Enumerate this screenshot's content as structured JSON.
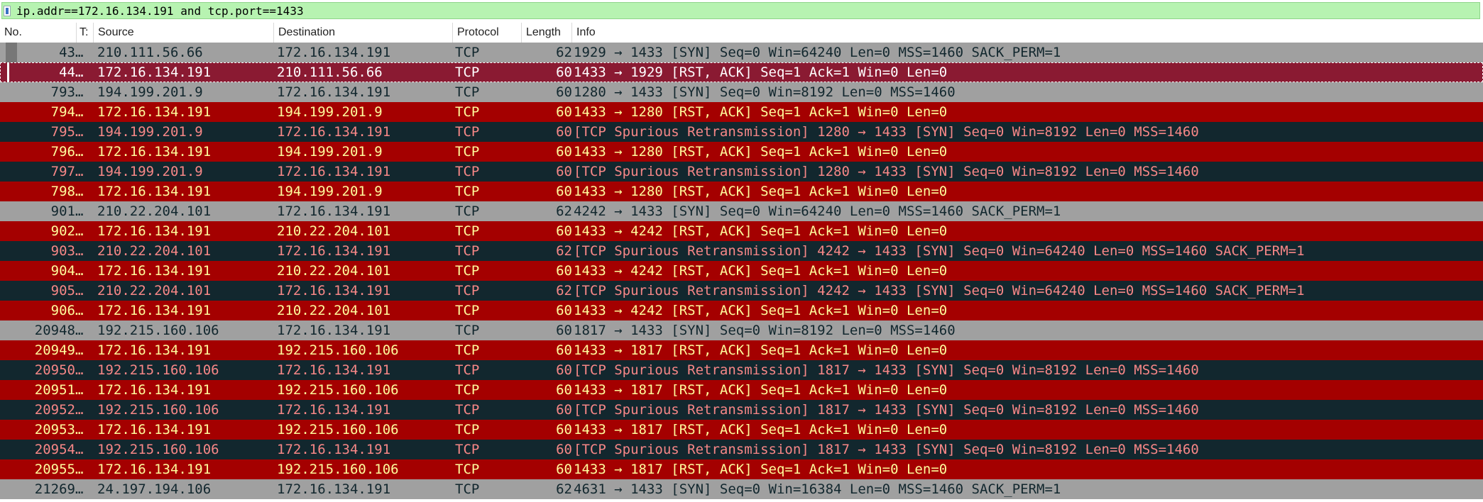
{
  "filter": {
    "text": "ip.addr==172.16.134.191 and tcp.port==1433"
  },
  "columns": [
    "No.",
    "T:",
    "Source",
    "Destination",
    "Protocol",
    "Length",
    "Info"
  ],
  "colors": {
    "syn": {
      "bg": "#a0a0a0",
      "fg": "#12272e"
    },
    "rst": {
      "bg": "#a40000",
      "fg": "#fffc9c"
    },
    "retrans": {
      "bg": "#12272e",
      "fg": "#f78787"
    },
    "selected": {
      "bg": "#8a1a32",
      "fg": "#ffffff"
    },
    "filter_bg": "#b7f3b1"
  },
  "packets": [
    {
      "no": "43",
      "more": "…",
      "src": "210.111.56.66",
      "dst": "172.16.134.191",
      "proto": "TCP",
      "len": "62",
      "info": "1929 → 1433 [SYN] Seq=0 Win=64240 Len=0 MSS=1460 SACK_PERM=1",
      "style": "syn"
    },
    {
      "no": "44",
      "more": "…",
      "src": "172.16.134.191",
      "dst": "210.111.56.66",
      "proto": "TCP",
      "len": "60",
      "info": "1433 → 1929 [RST, ACK] Seq=1 Ack=1 Win=0 Len=0",
      "style": "selected"
    },
    {
      "no": "793",
      "more": "…",
      "src": "194.199.201.9",
      "dst": "172.16.134.191",
      "proto": "TCP",
      "len": "60",
      "info": "1280 → 1433 [SYN] Seq=0 Win=8192 Len=0 MSS=1460",
      "style": "syn"
    },
    {
      "no": "794",
      "more": "…",
      "src": "172.16.134.191",
      "dst": "194.199.201.9",
      "proto": "TCP",
      "len": "60",
      "info": "1433 → 1280 [RST, ACK] Seq=1 Ack=1 Win=0 Len=0",
      "style": "rst"
    },
    {
      "no": "795",
      "more": "…",
      "src": "194.199.201.9",
      "dst": "172.16.134.191",
      "proto": "TCP",
      "len": "60",
      "info": "[TCP Spurious Retransmission] 1280 → 1433 [SYN] Seq=0 Win=8192 Len=0 MSS=1460",
      "style": "retrans"
    },
    {
      "no": "796",
      "more": "…",
      "src": "172.16.134.191",
      "dst": "194.199.201.9",
      "proto": "TCP",
      "len": "60",
      "info": "1433 → 1280 [RST, ACK] Seq=1 Ack=1 Win=0 Len=0",
      "style": "rst"
    },
    {
      "no": "797",
      "more": "…",
      "src": "194.199.201.9",
      "dst": "172.16.134.191",
      "proto": "TCP",
      "len": "60",
      "info": "[TCP Spurious Retransmission] 1280 → 1433 [SYN] Seq=0 Win=8192 Len=0 MSS=1460",
      "style": "retrans"
    },
    {
      "no": "798",
      "more": "…",
      "src": "172.16.134.191",
      "dst": "194.199.201.9",
      "proto": "TCP",
      "len": "60",
      "info": "1433 → 1280 [RST, ACK] Seq=1 Ack=1 Win=0 Len=0",
      "style": "rst"
    },
    {
      "no": "901",
      "more": "…",
      "src": "210.22.204.101",
      "dst": "172.16.134.191",
      "proto": "TCP",
      "len": "62",
      "info": "4242 → 1433 [SYN] Seq=0 Win=64240 Len=0 MSS=1460 SACK_PERM=1",
      "style": "syn"
    },
    {
      "no": "902",
      "more": "…",
      "src": "172.16.134.191",
      "dst": "210.22.204.101",
      "proto": "TCP",
      "len": "60",
      "info": "1433 → 4242 [RST, ACK] Seq=1 Ack=1 Win=0 Len=0",
      "style": "rst"
    },
    {
      "no": "903",
      "more": "…",
      "src": "210.22.204.101",
      "dst": "172.16.134.191",
      "proto": "TCP",
      "len": "62",
      "info": "[TCP Spurious Retransmission] 4242 → 1433 [SYN] Seq=0 Win=64240 Len=0 MSS=1460 SACK_PERM=1",
      "style": "retrans"
    },
    {
      "no": "904",
      "more": "…",
      "src": "172.16.134.191",
      "dst": "210.22.204.101",
      "proto": "TCP",
      "len": "60",
      "info": "1433 → 4242 [RST, ACK] Seq=1 Ack=1 Win=0 Len=0",
      "style": "rst"
    },
    {
      "no": "905",
      "more": "…",
      "src": "210.22.204.101",
      "dst": "172.16.134.191",
      "proto": "TCP",
      "len": "62",
      "info": "[TCP Spurious Retransmission] 4242 → 1433 [SYN] Seq=0 Win=64240 Len=0 MSS=1460 SACK_PERM=1",
      "style": "retrans"
    },
    {
      "no": "906",
      "more": "…",
      "src": "172.16.134.191",
      "dst": "210.22.204.101",
      "proto": "TCP",
      "len": "60",
      "info": "1433 → 4242 [RST, ACK] Seq=1 Ack=1 Win=0 Len=0",
      "style": "rst"
    },
    {
      "no": "20948",
      "more": "…",
      "src": "192.215.160.106",
      "dst": "172.16.134.191",
      "proto": "TCP",
      "len": "60",
      "info": "1817 → 1433 [SYN] Seq=0 Win=8192 Len=0 MSS=1460",
      "style": "syn"
    },
    {
      "no": "20949",
      "more": "…",
      "src": "172.16.134.191",
      "dst": "192.215.160.106",
      "proto": "TCP",
      "len": "60",
      "info": "1433 → 1817 [RST, ACK] Seq=1 Ack=1 Win=0 Len=0",
      "style": "rst"
    },
    {
      "no": "20950",
      "more": "…",
      "src": "192.215.160.106",
      "dst": "172.16.134.191",
      "proto": "TCP",
      "len": "60",
      "info": "[TCP Spurious Retransmission] 1817 → 1433 [SYN] Seq=0 Win=8192 Len=0 MSS=1460",
      "style": "retrans"
    },
    {
      "no": "20951",
      "more": "…",
      "src": "172.16.134.191",
      "dst": "192.215.160.106",
      "proto": "TCP",
      "len": "60",
      "info": "1433 → 1817 [RST, ACK] Seq=1 Ack=1 Win=0 Len=0",
      "style": "rst"
    },
    {
      "no": "20952",
      "more": "…",
      "src": "192.215.160.106",
      "dst": "172.16.134.191",
      "proto": "TCP",
      "len": "60",
      "info": "[TCP Spurious Retransmission] 1817 → 1433 [SYN] Seq=0 Win=8192 Len=0 MSS=1460",
      "style": "retrans"
    },
    {
      "no": "20953",
      "more": "…",
      "src": "172.16.134.191",
      "dst": "192.215.160.106",
      "proto": "TCP",
      "len": "60",
      "info": "1433 → 1817 [RST, ACK] Seq=1 Ack=1 Win=0 Len=0",
      "style": "rst"
    },
    {
      "no": "20954",
      "more": "…",
      "src": "192.215.160.106",
      "dst": "172.16.134.191",
      "proto": "TCP",
      "len": "60",
      "info": "[TCP Spurious Retransmission] 1817 → 1433 [SYN] Seq=0 Win=8192 Len=0 MSS=1460",
      "style": "retrans"
    },
    {
      "no": "20955",
      "more": "…",
      "src": "172.16.134.191",
      "dst": "192.215.160.106",
      "proto": "TCP",
      "len": "60",
      "info": "1433 → 1817 [RST, ACK] Seq=1 Ack=1 Win=0 Len=0",
      "style": "rst"
    },
    {
      "no": "21269",
      "more": "…",
      "src": "24.197.194.106",
      "dst": "172.16.134.191",
      "proto": "TCP",
      "len": "62",
      "info": "4631 → 1433 [SYN] Seq=0 Win=16384 Len=0 MSS=1460 SACK_PERM=1",
      "style": "syn"
    }
  ]
}
